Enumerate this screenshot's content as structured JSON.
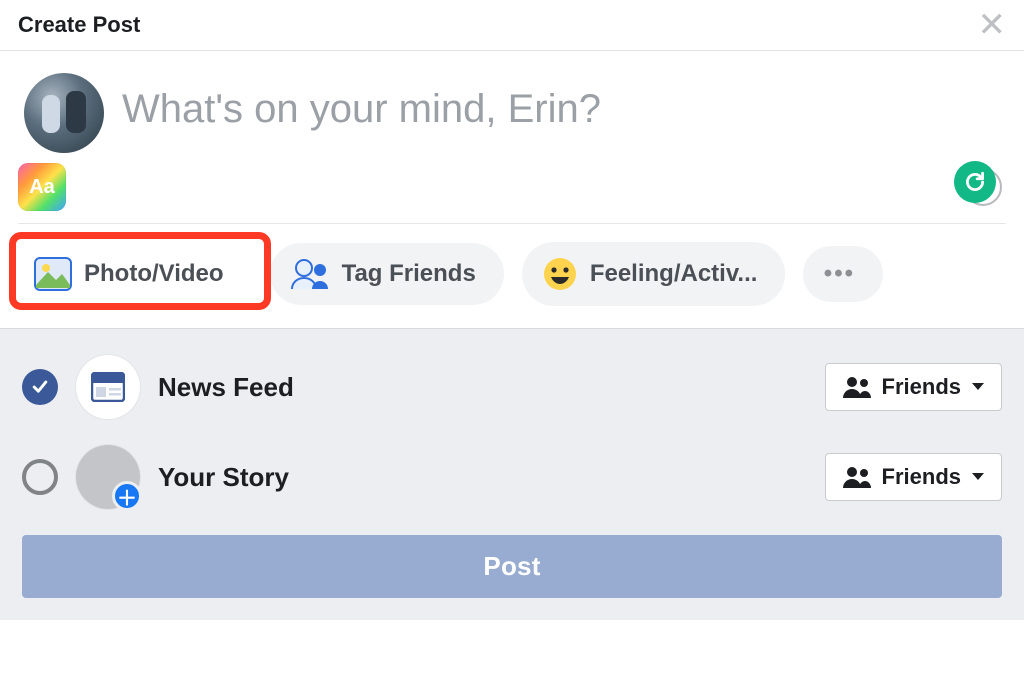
{
  "header": {
    "title": "Create Post"
  },
  "compose": {
    "placeholder": "What's on your mind, Erin?",
    "bg_button_label": "Aa"
  },
  "options": [
    {
      "key": "photo_video",
      "label": "Photo/Video",
      "highlighted": true
    },
    {
      "key": "tag_friends",
      "label": "Tag Friends"
    },
    {
      "key": "feeling",
      "label": "Feeling/Activ..."
    }
  ],
  "more_label": "•••",
  "share_targets": [
    {
      "key": "news_feed",
      "label": "News Feed",
      "selected": true,
      "privacy": "Friends"
    },
    {
      "key": "your_story",
      "label": "Your Story",
      "selected": false,
      "privacy": "Friends"
    }
  ],
  "post_button": "Post"
}
